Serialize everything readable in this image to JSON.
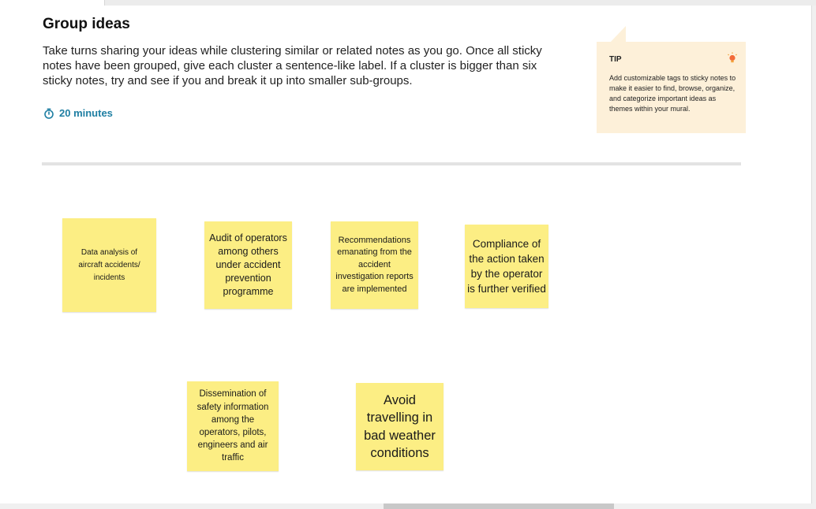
{
  "activity": {
    "title": "Group ideas",
    "description": "Take turns sharing your ideas while clustering similar or related notes as you go. Once all sticky notes have been grouped, give each cluster a sentence-like label. If a cluster is bigger than six sticky notes, try and see if you and break it up into smaller sub-groups.",
    "timer_label": "20 minutes",
    "timer_icon": "stopwatch-icon",
    "accent_color": "#1f7fa3"
  },
  "tip": {
    "label": "TIP",
    "text": "Add customizable tags to sticky notes to make it easier to find, browse, organize, and categorize important ideas as themes within your mural.",
    "icon": "lightbulb-icon",
    "background_color": "#fdf0d9"
  },
  "sticky_notes": [
    {
      "text": "Data analysis of aircraft accidents/ incidents"
    },
    {
      "text": "Audit of operators among others under accident prevention programme"
    },
    {
      "text": "Recommendations emanating from the accident investigation reports are implemented"
    },
    {
      "text": "Compliance of the action taken by the operator is further verified"
    },
    {
      "text": "Dissemination of safety information among the operators, pilots, engineers and air traffic"
    },
    {
      "text": "Avoid travelling in bad weather conditions"
    }
  ],
  "sticky_color": "#fcee84"
}
